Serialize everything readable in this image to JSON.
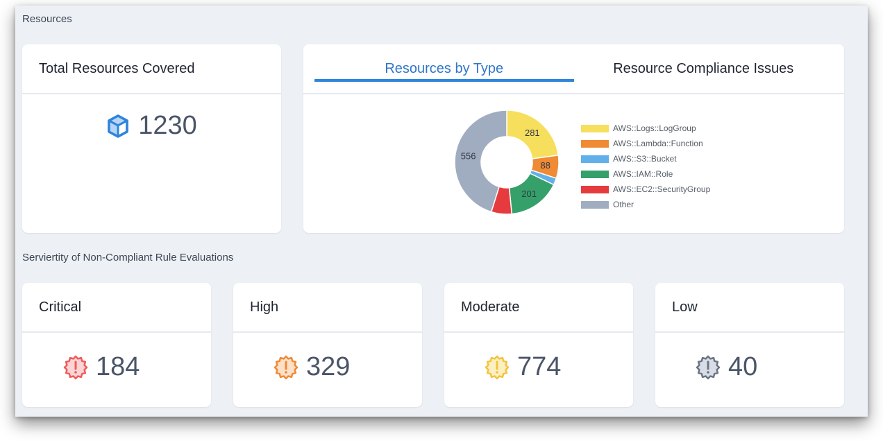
{
  "sections": {
    "resources_title": "Resources",
    "severity_title": "Serviertity of Non-Compliant Rule Evaluations"
  },
  "total_card": {
    "title": "Total Resources Covered",
    "icon": "cube-icon",
    "value": "1230",
    "icon_color": "#2f84db"
  },
  "chart_card": {
    "tabs": [
      {
        "label": "Resources by Type",
        "active": true
      },
      {
        "label": "Resource Compliance Issues",
        "active": false
      }
    ]
  },
  "chart_data": {
    "type": "pie",
    "variant": "doughnut",
    "title": "Resources by Type",
    "legend_position": "right",
    "categories": [
      "AWS::Logs::LogGroup",
      "AWS::Lambda::Function",
      "AWS::S3::Bucket",
      "AWS::IAM::Role",
      "AWS::EC2::SecurityGroup",
      "Other"
    ],
    "values": [
      281,
      88,
      26,
      201,
      78,
      556
    ],
    "data_labels": [
      "281",
      "88",
      "",
      "201",
      "",
      "556"
    ],
    "colors": [
      "#f7df5e",
      "#ef8a35",
      "#62b0ea",
      "#35a06a",
      "#e63b3e",
      "#a0adc0"
    ]
  },
  "severity": [
    {
      "label": "Critical",
      "value": "184",
      "icon": "alert-badge-icon",
      "stroke": "#ef5b5b",
      "fill": "#fbd5d5"
    },
    {
      "label": "High",
      "value": "329",
      "icon": "alert-badge-icon",
      "stroke": "#ef8a35",
      "fill": "#fde0c8"
    },
    {
      "label": "Moderate",
      "value": "774",
      "icon": "alert-badge-icon",
      "stroke": "#f2c43d",
      "fill": "#fcefc2"
    },
    {
      "label": "Low",
      "value": "40",
      "icon": "alert-badge-icon",
      "stroke": "#6b7585",
      "fill": "#d9dee6"
    }
  ]
}
